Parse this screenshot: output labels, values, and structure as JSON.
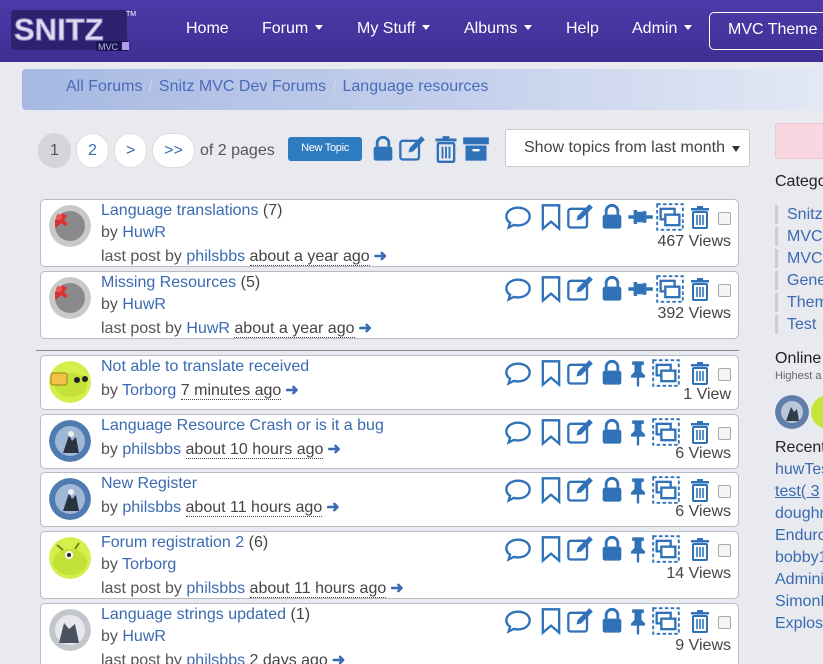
{
  "colors": {
    "navbar": "#4c3aa8",
    "accent_blue": "#3a6ab1",
    "icon_blue": "#2f72b8",
    "new_topic_bg": "#2f7bbf",
    "breadcrumb_bg": "#a7b9e2",
    "page_bg": "#e8eaef"
  },
  "navbar": {
    "logo_text": "SNITZ",
    "logo_tm": "TM",
    "logo_sub": "MVC",
    "items": [
      {
        "label": "Home"
      },
      {
        "label": "Forum"
      },
      {
        "label": "My Stuff"
      },
      {
        "label": "Albums"
      },
      {
        "label": "Help"
      },
      {
        "label": "Admin"
      }
    ],
    "theme_button": "MVC Theme"
  },
  "breadcrumb": [
    "All Forums",
    "Snitz MVC Dev Forums",
    "Language resources"
  ],
  "pagination": {
    "pages": [
      "1",
      "2"
    ],
    "next": ">",
    "last": ">>",
    "of_text": "of 2 pages",
    "current": "1"
  },
  "toolbar": {
    "new_topic": "New Topic",
    "icons": [
      "lock-icon",
      "edit-icon",
      "trash-icon",
      "archive-icon"
    ],
    "filter_selected": "Show topics from last month"
  },
  "topics": [
    {
      "title": "Language translations",
      "replies": "(7)",
      "by_label": "by",
      "author": "HuwR",
      "last_label": "last post by",
      "last_user": "philsbbs",
      "ago": "about a year ago",
      "views": "467 Views",
      "pinned": true,
      "avatar": "sticky"
    },
    {
      "title": "Missing Resources",
      "replies": "(5)",
      "by_label": "by",
      "author": "HuwR",
      "last_label": "last post by",
      "last_user": "HuwR",
      "ago": "about a year ago",
      "views": "392 Views",
      "pinned": true,
      "avatar": "sticky"
    },
    {
      "title": "Not able to translate received",
      "replies": "",
      "by_label": "by",
      "author": "Torborg",
      "ago": "7 minutes ago",
      "views": "1 View",
      "pinned": false,
      "avatar": "alien-folder"
    },
    {
      "title": "Language Resource Crash or is it a bug",
      "replies": "",
      "by_label": "by",
      "author": "philsbbs",
      "ago": "about 10 hours ago",
      "views": "6 Views",
      "pinned": false,
      "avatar": "photo"
    },
    {
      "title": "New Register",
      "replies": "",
      "by_label": "by",
      "author": "philsbbs",
      "ago": "about 11 hours ago",
      "views": "6 Views",
      "pinned": false,
      "avatar": "photo"
    },
    {
      "title": "Forum registration 2",
      "replies": "(6)",
      "by_label": "by",
      "author": "Torborg",
      "last_label": "last post by",
      "last_user": "philsbbs",
      "ago": "about 11 hours ago",
      "views": "14 Views",
      "pinned": false,
      "avatar": "alien"
    },
    {
      "title": "Language strings updated",
      "replies": "(1)",
      "by_label": "by",
      "author": "HuwR",
      "last_label": "last post by",
      "last_user": "philsbbs",
      "ago": "2 days ago",
      "views": "9 Views",
      "pinned": false,
      "avatar": "photo-gray"
    }
  ],
  "sidebar": {
    "categories_heading": "Catego",
    "categories": [
      "Snitz",
      "MVC",
      "MVC",
      "Gene",
      "Them",
      "Test"
    ],
    "online_heading": "Online",
    "online_sub": "Highest a",
    "recent_heading": "Recent",
    "recent": [
      "huwTes",
      "test( 3",
      "doughn",
      "Enduro",
      "bobby1",
      "Admini",
      "SimonE",
      "Explos"
    ]
  }
}
